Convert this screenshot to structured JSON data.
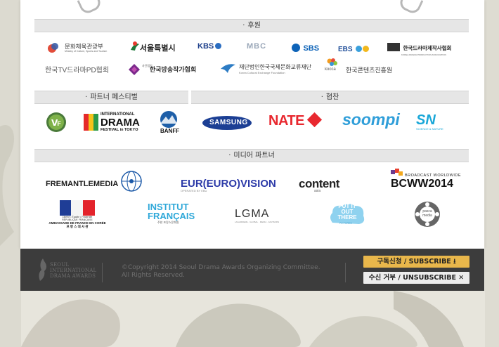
{
  "sections": {
    "sponsors": "후원",
    "festival_partners": "파트너 페스티벌",
    "cooperation": "협찬",
    "media_partners": "미디어 파트너"
  },
  "sponsors_logos": {
    "mcst": "문화체육관광부",
    "mcst_en": "Ministry of Culture, Sports and Tourism",
    "seoul": "서울특별시",
    "kbs": "KBS",
    "mbc": "MBC",
    "sbs": "SBS",
    "ebs": "EBS",
    "kdpa": "한국드라마제작사협회",
    "kdpa_en": "KOREA DRAMA PRODUCTION ASSOCIATION",
    "ktvpd": "한국TV드라마PD협회",
    "kbwa_small": "사단법인",
    "kbwa": "한국방송작가협회",
    "kofice": "재단법인한국국제문화교류재단",
    "kofice_en": "Korea Cultural Exchange Foundation",
    "kocca_small": "kocca",
    "kocca": "한국콘텐츠진흥원"
  },
  "festival_logos": {
    "drama_line1": "INTERNATIONAL",
    "drama_line2": "DRAMA",
    "drama_line3": "FESTIVAL in TOKYO",
    "banff": "BANFF"
  },
  "cooperation_logos": {
    "samsung": "SAMSUNG",
    "nate": "NATE",
    "soompi": "soompi",
    "sn": "SN",
    "sn_sub": "SCIENCE & NATURE"
  },
  "media_logos": {
    "fremantle": "FREMANTLEMEDIA",
    "eurovision": "EURO)VISION",
    "eurovision_prefix": "EUR(",
    "eurovision_sub": "OPERATED BY EBU",
    "content": "content",
    "content_sub": "asia",
    "bcww_top": "BROADCAST WORLDWIDE",
    "bcww": "BCWW2014",
    "ambassade_l1": "Liberté • Égalité • Fraternité",
    "ambassade_l2": "RÉPUBLIQUE FRANÇAISE",
    "ambassade_l3": "AMBASSADE DE FRANCE EN CORÉE",
    "ambassade_l4": "프 랑 스   대 사 관",
    "institut_l1": "INSTITUT",
    "institut_l2": "FRANÇAIS",
    "institut_sub": "주한 프랑스문화원",
    "lgma": "LGMA",
    "lgma_sub": "LAGARDERE · GLOBAL · MEDIA · ADVISORS",
    "putitout_l1": "PUT IT",
    "putitout_l2": "OUT",
    "putitout_l3": "THERE",
    "putitout_sub": "PICTURES",
    "pasca_l1": "pasca",
    "pasca_l2": "media"
  },
  "footer": {
    "logo_l1": "SEOUL",
    "logo_l2": "INTERNATIONAL",
    "logo_l3": "DRAMA AWARDS",
    "copyright_l1": "©Copyright 2014 Seoul Drama Awards Organizing Committee.",
    "copyright_l2": "All Rights Reserved.",
    "subscribe": "구독신청 / SUBSCRIBE ⭳",
    "unsubscribe": "수신 거부 / UNSUBSCRIBE ✕"
  },
  "colors": {
    "accent_gold": "#e9b74b",
    "footer_bg": "#3c3c3c",
    "section_bar": "#e6e6e6"
  }
}
